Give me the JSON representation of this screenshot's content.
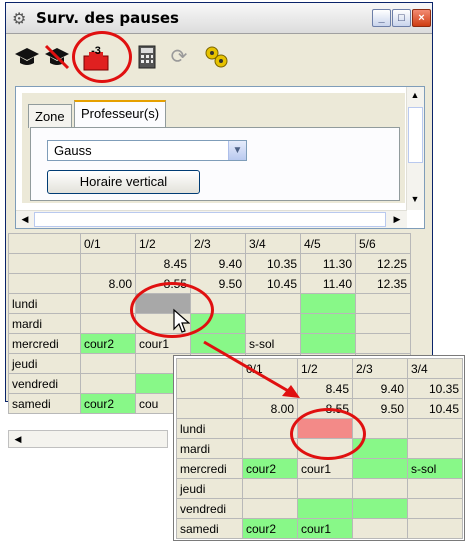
{
  "window": {
    "title": "Surv. des pauses",
    "controls": [
      "_",
      "□",
      "×"
    ]
  },
  "toolbar": {
    "badge_number": "-3"
  },
  "tabs": [
    "Zone",
    "Professeur(s)"
  ],
  "professor_select": {
    "value": "Gauss"
  },
  "vertical_button": {
    "label": "Horaire vertical"
  },
  "grid_main": {
    "columns": [
      "0/1",
      "1/2",
      "2/3",
      "3/4",
      "4/5",
      "5/6"
    ],
    "start_times": [
      "",
      "8.45",
      "9.40",
      "10.35",
      "11.30",
      "12.25"
    ],
    "end_times": [
      "8.00",
      "8.55",
      "9.50",
      "10.45",
      "11.40",
      "12.35"
    ],
    "rows": [
      {
        "day": "lundi",
        "cells": [
          "",
          "",
          "",
          "",
          "",
          ""
        ]
      },
      {
        "day": "mardi",
        "cells": [
          "",
          "",
          "",
          "",
          "",
          ""
        ]
      },
      {
        "day": "mercredi",
        "cells": [
          "cour2",
          "cour1",
          "",
          "s-sol",
          "",
          ""
        ]
      },
      {
        "day": "jeudi",
        "cells": [
          "",
          "",
          "",
          "",
          "",
          ""
        ]
      },
      {
        "day": "vendredi",
        "cells": [
          "",
          "",
          "",
          "",
          "",
          ""
        ]
      },
      {
        "day": "samedi",
        "cells": [
          "cour2",
          "cou",
          "",
          "",
          "",
          ""
        ]
      }
    ]
  },
  "grid_zoom": {
    "columns": [
      "0/1",
      "1/2",
      "2/3",
      "3/4"
    ],
    "start_times": [
      "",
      "8.45",
      "9.40",
      "10.35"
    ],
    "end_times": [
      "8.00",
      "8.55",
      "9.50",
      "10.45"
    ],
    "rows": [
      {
        "day": "lundi",
        "cells": [
          "",
          "",
          "",
          ""
        ]
      },
      {
        "day": "mardi",
        "cells": [
          "",
          "",
          "",
          ""
        ]
      },
      {
        "day": "mercredi",
        "cells": [
          "cour2",
          "cour1",
          "",
          "s-sol"
        ]
      },
      {
        "day": "jeudi",
        "cells": [
          "",
          "",
          "",
          ""
        ]
      },
      {
        "day": "vendredi",
        "cells": [
          "",
          "",
          "",
          ""
        ]
      },
      {
        "day": "samedi",
        "cells": [
          "cour2",
          "cour1",
          "",
          ""
        ]
      }
    ]
  },
  "colors": {
    "free_slot": "#88f888",
    "selected_slot": "#a8a8a8",
    "deleted_slot": "#f38a88",
    "annotation": "#e01010"
  },
  "icons": [
    "gear-icon",
    "graduation-cap-icon",
    "graduation-cap-crossed-icon",
    "counter-minus-icon",
    "calculator-icon",
    "refresh-icon",
    "gears-icon",
    "cursor-arrow-icon"
  ]
}
